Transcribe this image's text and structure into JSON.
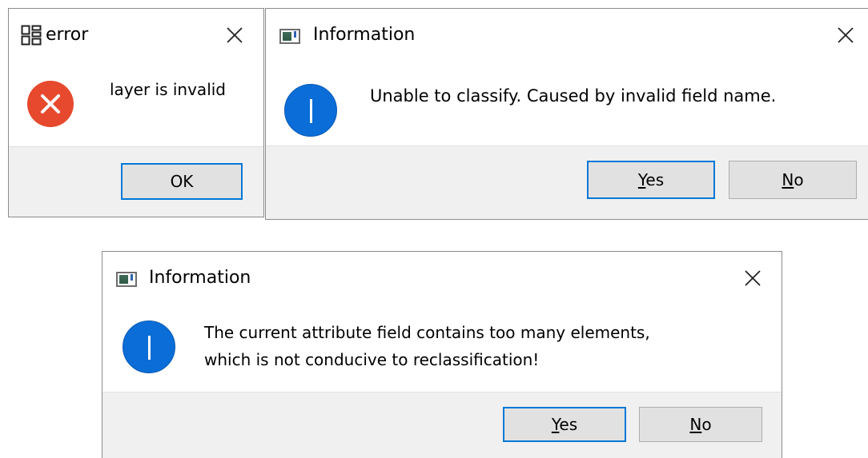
{
  "dialogs": [
    {
      "title": "error",
      "message": "layer is invalid",
      "icon": "error-icon",
      "buttons": [
        {
          "label": "OK",
          "default": true
        }
      ]
    },
    {
      "title": "Information",
      "message": "Unable to classify. Caused by invalid field name.",
      "icon": "information-icon",
      "buttons": [
        {
          "mnemonic": "Y",
          "rest": "es",
          "default": true
        },
        {
          "mnemonic": "N",
          "rest": "o",
          "default": false
        }
      ]
    },
    {
      "title": "Information",
      "message_lines": [
        "The current attribute field contains too many elements,",
        "which is not conducive to reclassification!"
      ],
      "icon": "information-icon",
      "buttons": [
        {
          "mnemonic": "Y",
          "rest": "es",
          "default": true
        },
        {
          "mnemonic": "N",
          "rest": "o",
          "default": false
        }
      ]
    }
  ],
  "colors": {
    "accent_border": "#0078d7",
    "info_icon": "#0b6dd7",
    "error_icon": "#e6492d",
    "footer_bg": "#f0f0f0",
    "button_bg": "#e1e1e1"
  }
}
